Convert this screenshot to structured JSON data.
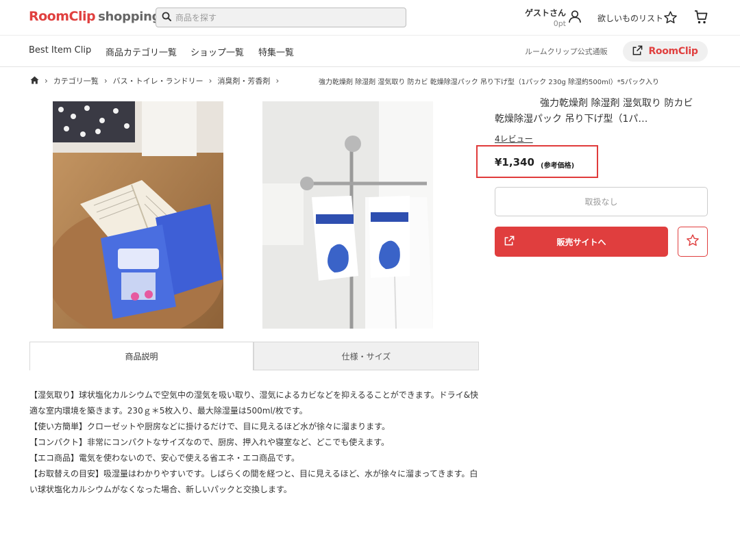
{
  "header": {
    "logo_main": "RoomClip",
    "logo_sub": "shopping",
    "search_placeholder": "商品を探す",
    "user_name": "ゲストさん",
    "user_points": "0pt",
    "wishlist_label": "欲しいものリスト"
  },
  "nav": {
    "items": [
      "Best Item Clip",
      "商品カテゴリ一覧",
      "ショップ一覧",
      "特集一覧"
    ],
    "official_label": "ルームクリップ公式通販",
    "roomclip_button": "RoomClip"
  },
  "breadcrumb": {
    "items": [
      "カテゴリ一覧",
      "バス・トイレ・ランドリー",
      "消臭剤・芳香剤"
    ],
    "current": "強力乾燥剤 除湿剤 湿気取り 防カビ 乾燥除湿パック 吊り下げ型（1パック 230g 除湿約500ml）*5パック入り"
  },
  "product": {
    "title": "強力乾燥剤 除湿剤 湿気取り 防カビ 乾燥除湿パック 吊り下げ型（1パ…",
    "reviews": "4レビュー",
    "price": "¥1,340",
    "price_note": "(参考価格)",
    "unavailable_label": "取扱なし",
    "sale_site_label": "販売サイトへ"
  },
  "tabs": [
    {
      "label": "商品説明",
      "active": true
    },
    {
      "label": "仕様・サイズ",
      "active": false
    }
  ],
  "description": [
    "【湿気取り】球状塩化カルシウムで空気中の湿気を吸い取り、湿気によるカビなどを抑えるることができます。ドライ&快適な室内環境を築きます。230ｇ＊5枚入り、最大除湿量は500ml/枚です。",
    "【使い方簡単】クローゼットや厨房などに掛けるだけで、目に見えるほど水が徐々に溜まります。",
    "【コンパクト】非常にコンパクトなサイズなので、厨房、押入れや寝室など、どこでも使えます。",
    "【エコ商品】電気を使わないので、安心で使える省エネ・エコ商品です。",
    "【お取替えの目安】吸湿量はわかりやすいです。しばらくの間を経つと、目に見えるほど、水が徐々に溜まってきます。白い球状塩化カルシウムがなくなった場合、新しいパックと交換します。"
  ],
  "colors": {
    "brand_red": "#e0403f",
    "price_highlight": "#e03a3a",
    "cta_red": "#e03e3e"
  },
  "icons": [
    "search-icon",
    "user-icon",
    "star-icon",
    "cart-icon",
    "home-icon",
    "external-link-icon"
  ]
}
